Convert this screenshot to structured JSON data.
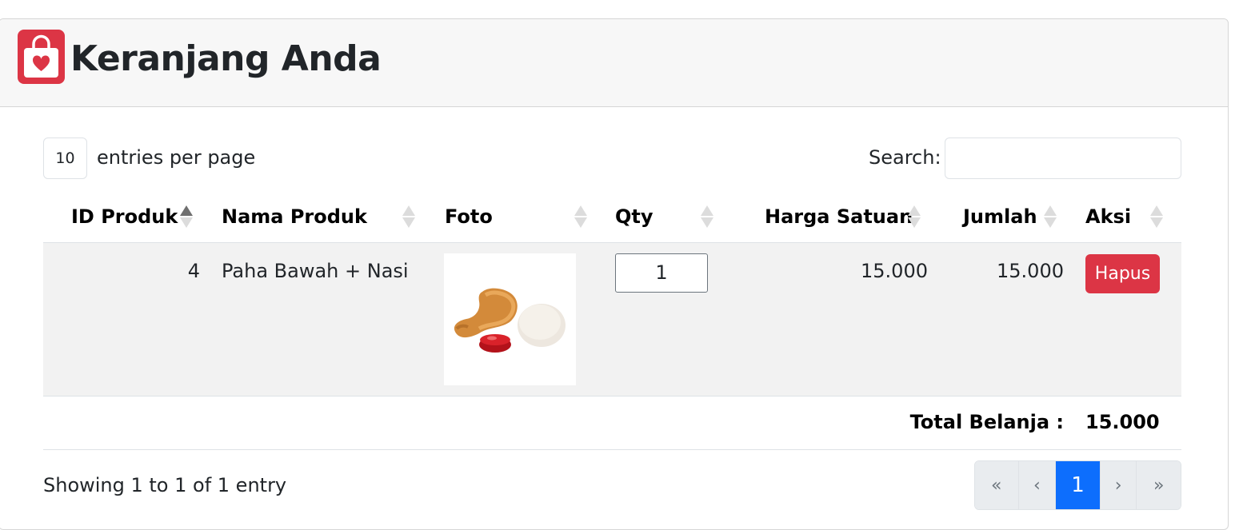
{
  "header": {
    "title": "Keranjang Anda",
    "icon": "shopping-bag-heart-icon",
    "icon_color": "#dc3545"
  },
  "controls": {
    "entries_value": "10",
    "entries_label": "entries per page",
    "search_label": "Search:",
    "search_value": ""
  },
  "table": {
    "columns": [
      {
        "label": "ID Produk",
        "sorted": "asc"
      },
      {
        "label": "Nama Produk",
        "sorted": "none"
      },
      {
        "label": "Foto",
        "sorted": "none"
      },
      {
        "label": "Qty",
        "sorted": "none"
      },
      {
        "label": "Harga Satuan",
        "sorted": "none"
      },
      {
        "label": "Jumlah",
        "sorted": "none"
      },
      {
        "label": "Aksi",
        "sorted": "none"
      }
    ],
    "rows": [
      {
        "id": "4",
        "name": "Paha Bawah + Nasi",
        "photo": "fried-chicken-with-rice-and-sauce",
        "qty": "1",
        "price": "15.000",
        "subtotal": "15.000",
        "action": "Hapus"
      }
    ],
    "total_label": "Total Belanja :",
    "total_value": "15.000"
  },
  "footer": {
    "info": "Showing 1 to 1 of 1 entry",
    "pagination": [
      "«",
      "‹",
      "1",
      "›",
      "»"
    ],
    "current_page": "1"
  },
  "colors": {
    "primary": "#0d6efd",
    "danger": "#dc3545",
    "row_bg": "#f2f2f2"
  }
}
